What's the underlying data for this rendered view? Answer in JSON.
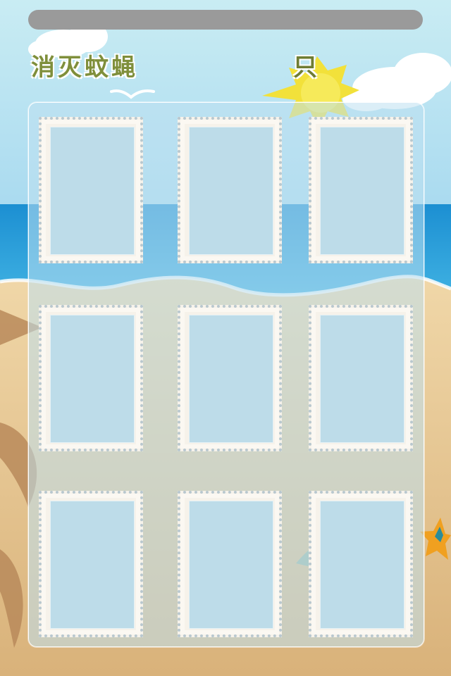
{
  "header": {
    "title": "消灭蚊蝇",
    "unit": "只"
  },
  "grid": {
    "rows": 3,
    "cols": 3,
    "slots": [
      {
        "id": 1
      },
      {
        "id": 2
      },
      {
        "id": 3
      },
      {
        "id": 4
      },
      {
        "id": 5
      },
      {
        "id": 6
      },
      {
        "id": 7
      },
      {
        "id": 8
      },
      {
        "id": 9
      }
    ]
  },
  "colors": {
    "sky": "#bfe3ef",
    "sea": "#2aa0d8",
    "sand": "#e6c79a",
    "sun": "#f2e13a",
    "title_text": "#7f8f3b",
    "top_bar": "#9a9a9a",
    "starfish": "#f0a020"
  },
  "icons": [
    "cloud-icon",
    "sun-icon",
    "seagull-icon",
    "palm-leaf-icon",
    "starfish-icon",
    "seashell-icon"
  ]
}
